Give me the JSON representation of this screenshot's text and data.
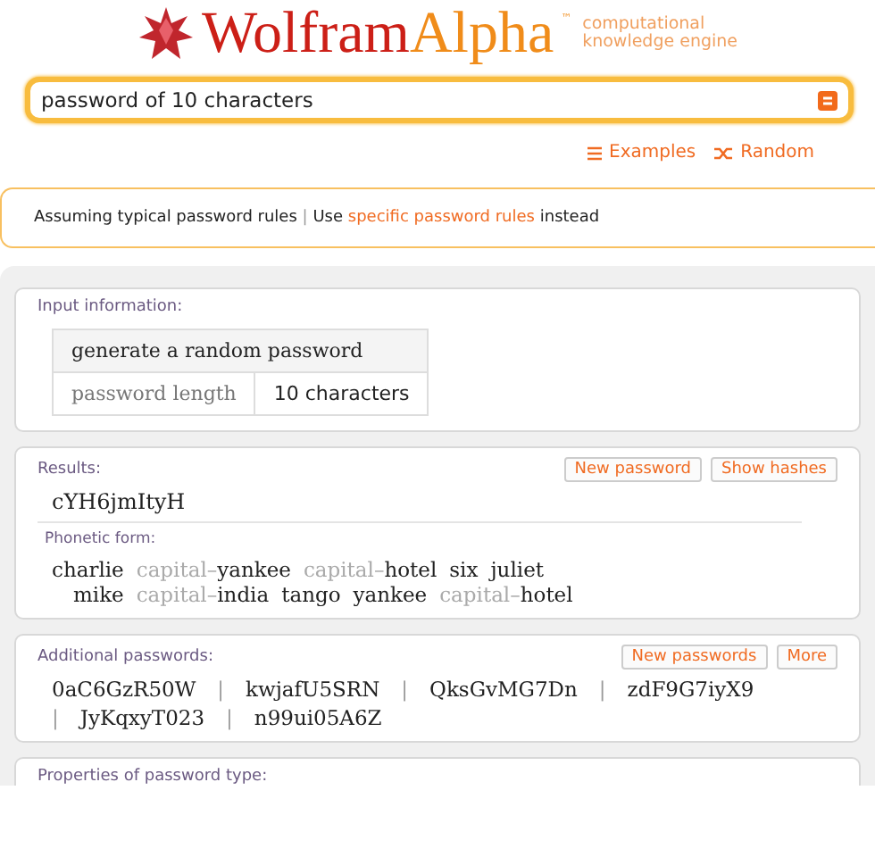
{
  "logo": {
    "word_1": "Wolfram",
    "word_2": "Alpha",
    "trademark": "™",
    "tagline_1": "computational",
    "tagline_2": "knowledge engine"
  },
  "search": {
    "value": "password of 10 characters"
  },
  "links": [
    {
      "kind": "examples",
      "label": "Examples"
    },
    {
      "kind": "random",
      "label": "Random"
    }
  ],
  "assumption": {
    "text": "Assuming typical password rules",
    "separator": "|",
    "use": "Use",
    "link": "specific password rules",
    "tail": "instead"
  },
  "pods": [
    {
      "kind": "table",
      "title": "Input information:",
      "header": "generate a random password",
      "rows": [
        {
          "label": "password length",
          "value": "10 characters"
        }
      ]
    },
    {
      "kind": "result",
      "title": "Results:",
      "buttons": [
        "New password",
        "Show hashes"
      ],
      "value": "cYH6jmItyH",
      "subtitle": "Phonetic form:",
      "lines": [
        [
          {
            "kind": "word",
            "text": "charlie"
          },
          {
            "kind": "prefix",
            "text": "capital–"
          },
          {
            "kind": "word",
            "text": "yankee"
          },
          {
            "kind": "prefix",
            "text": "capital–"
          },
          {
            "kind": "word",
            "text": "hotel"
          },
          {
            "kind": "word",
            "text": "six"
          },
          {
            "kind": "word",
            "text": "juliet"
          }
        ],
        [
          {
            "kind": "word",
            "text": "mike"
          },
          {
            "kind": "prefix",
            "text": "capital–"
          },
          {
            "kind": "word",
            "text": "india"
          },
          {
            "kind": "word",
            "text": "tango"
          },
          {
            "kind": "word",
            "text": "yankee"
          },
          {
            "kind": "prefix",
            "text": "capital–"
          },
          {
            "kind": "word",
            "text": "hotel"
          }
        ]
      ]
    },
    {
      "kind": "list",
      "title": "Additional passwords:",
      "buttons": [
        "New passwords",
        "More"
      ],
      "separator": "|",
      "items": [
        "0aC6GzR50W",
        "kwjafU5SRN",
        "QksGvMG7Dn",
        "zdF9G7iyX9",
        "JyKqxyT023",
        "n99ui05A6Z"
      ]
    },
    {
      "kind": "title",
      "title": "Properties of password type:"
    }
  ]
}
